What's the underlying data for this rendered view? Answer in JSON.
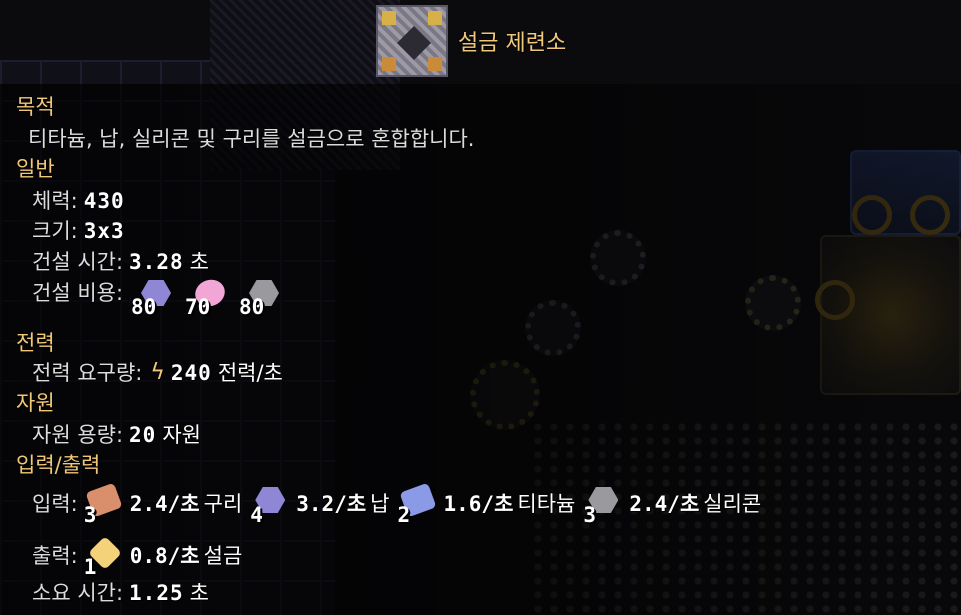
{
  "title": "설금 제련소",
  "sections": {
    "purpose": {
      "heading": "목적",
      "description": "티타늄, 납, 실리콘 및 구리를 설금으로 혼합합니다."
    },
    "general": {
      "heading": "일반",
      "health_label": "체력:",
      "health_value": "430",
      "size_label": "크기:",
      "size_value": "3x3",
      "build_time_label": "건설 시간:",
      "build_time_value": "3.28",
      "build_time_unit": "초",
      "build_cost_label": "건설 비용:",
      "build_cost": [
        {
          "amount": "80",
          "color": "#8f87d6",
          "icon": "lead-icon"
        },
        {
          "amount": "70",
          "color": "#f2a6d6",
          "icon": "phase-fabric-icon"
        },
        {
          "amount": "80",
          "color": "#9a9a9e",
          "icon": "silicon-icon"
        }
      ]
    },
    "power": {
      "heading": "전력",
      "use_label": "전력 요구량:",
      "use_value": "240",
      "use_unit": "전력/초"
    },
    "resources": {
      "heading": "자원",
      "capacity_label": "자원 용량:",
      "capacity_value": "20",
      "capacity_unit": "자원"
    },
    "io": {
      "heading": "입력/출력",
      "input_label": "입력:",
      "inputs": [
        {
          "count": "3",
          "rate": "2.4/초",
          "name": "구리",
          "color": "#d98f6b",
          "icon": "copper-icon"
        },
        {
          "count": "4",
          "rate": "3.2/초",
          "name": "납",
          "color": "#8f87d6",
          "icon": "lead-icon"
        },
        {
          "count": "2",
          "rate": "1.6/초",
          "name": "티타늄",
          "color": "#8a9ae6",
          "icon": "titanium-icon"
        },
        {
          "count": "3",
          "rate": "2.4/초",
          "name": "실리콘",
          "color": "#9a9a9e",
          "icon": "silicon-icon"
        }
      ],
      "output_label": "출력:",
      "output": {
        "count": "1",
        "rate": "0.8/초",
        "name": "설금",
        "color": "#f3d27a",
        "icon": "surge-alloy-icon"
      },
      "time_label": "소요 시간:",
      "time_value": "1.25",
      "time_unit": "초"
    }
  }
}
